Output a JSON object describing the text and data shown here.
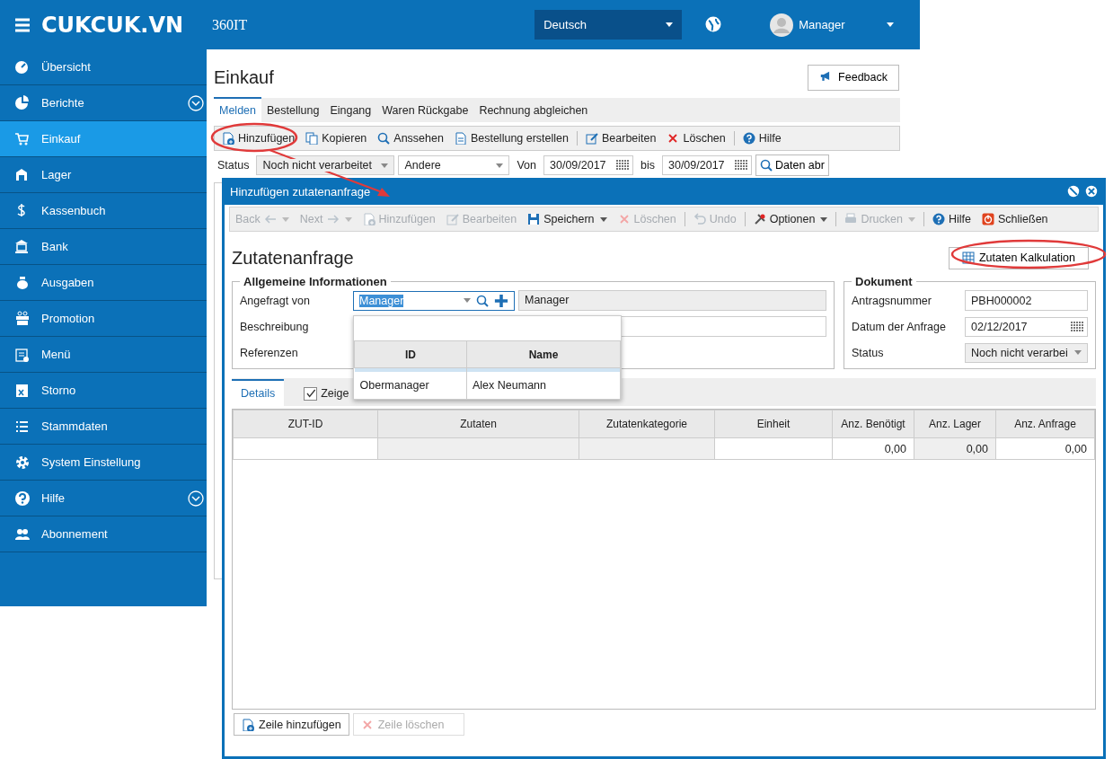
{
  "header": {
    "logo": "CUKCUK.VN",
    "company": "360IT",
    "language": "Deutsch",
    "user": "Manager"
  },
  "sidebar": {
    "items": [
      {
        "label": "Übersicht",
        "selected": false,
        "expandable": false
      },
      {
        "label": "Berichte",
        "selected": false,
        "expandable": true
      },
      {
        "label": "Einkauf",
        "selected": true,
        "expandable": false
      },
      {
        "label": "Lager",
        "selected": false,
        "expandable": false
      },
      {
        "label": "Kassenbuch",
        "selected": false,
        "expandable": false
      },
      {
        "label": "Bank",
        "selected": false,
        "expandable": false
      },
      {
        "label": "Ausgaben",
        "selected": false,
        "expandable": false
      },
      {
        "label": "Promotion",
        "selected": false,
        "expandable": false
      },
      {
        "label": "Menü",
        "selected": false,
        "expandable": false
      },
      {
        "label": "Storno",
        "selected": false,
        "expandable": false
      },
      {
        "label": "Stammdaten",
        "selected": false,
        "expandable": false
      },
      {
        "label": "System Einstellung",
        "selected": false,
        "expandable": false
      },
      {
        "label": "Hilfe",
        "selected": false,
        "expandable": true
      },
      {
        "label": "Abonnement",
        "selected": false,
        "expandable": false
      }
    ]
  },
  "page": {
    "title": "Einkauf",
    "feedback": "Feedback",
    "tabs": [
      {
        "label": "Melden",
        "selected": true
      },
      {
        "label": "Bestellung",
        "selected": false
      },
      {
        "label": "Eingang",
        "selected": false
      },
      {
        "label": "Waren Rückgabe",
        "selected": false
      },
      {
        "label": "Rechnung abgleichen",
        "selected": false
      }
    ],
    "toolbar": [
      {
        "label": "Hinzufügen"
      },
      {
        "label": "Kopieren"
      },
      {
        "label": "Anssehen"
      },
      {
        "label": "Bestellung erstellen"
      },
      {
        "label": "Bearbeiten"
      },
      {
        "label": "Löschen"
      },
      {
        "label": "Hilfe"
      }
    ],
    "filter": {
      "status_label": "Status",
      "status_value": "Noch nicht verarbeitet",
      "type_value": "Andere",
      "from_label": "Von",
      "from_date": "30/09/2017",
      "to_label": "bis",
      "to_date": "30/09/2017",
      "load_button": "Daten abr"
    }
  },
  "dialog": {
    "title": "Hinzufügen zutatenanfrage",
    "toolbar": [
      {
        "label": "Back",
        "disabled": true,
        "dropdown": true
      },
      {
        "label": "Next",
        "disabled": true,
        "dropdown": true
      },
      {
        "label": "Hinzufügen",
        "disabled": true,
        "dropdown": false
      },
      {
        "label": "Bearbeiten",
        "disabled": true,
        "dropdown": false
      },
      {
        "label": "Speichern",
        "disabled": false,
        "dropdown": true
      },
      {
        "label": "Löschen",
        "disabled": true,
        "dropdown": false
      },
      {
        "label": "Undo",
        "disabled": true,
        "dropdown": false
      },
      {
        "label": "Optionen",
        "disabled": false,
        "dropdown": true
      },
      {
        "label": "Drucken",
        "disabled": true,
        "dropdown": true
      },
      {
        "label": "Hilfe",
        "disabled": false,
        "dropdown": false
      },
      {
        "label": "Schließen",
        "disabled": false,
        "dropdown": false
      }
    ],
    "heading": "Zutatenanfrage",
    "calc_button": "Zutaten Kalkulation",
    "general": {
      "legend": "Allgemeine Informationen",
      "requested_by_label": "Angefragt von",
      "requested_by_value": "Manager",
      "requested_by_name": "Manager",
      "description_label": "Beschreibung",
      "references_label": "Referenzen"
    },
    "document": {
      "legend": "Dokument",
      "number_label": "Antragsnummer",
      "number_value": "PBH000002",
      "date_label": "Datum der Anfrage",
      "date_value": "02/12/2017",
      "status_label": "Status",
      "status_value": "Noch nicht verarbei"
    },
    "lookup": {
      "columns": [
        "ID",
        "Name"
      ],
      "rows": [
        [
          "Obermanager",
          "Alex Neumann"
        ]
      ]
    },
    "tabs": [
      {
        "label": "Details",
        "selected": true
      }
    ],
    "show_checkbox": {
      "label": "Zeige",
      "checked": true
    },
    "table": {
      "columns": [
        "ZUT-ID",
        "Zutaten",
        "Zutatenkategorie",
        "Einheit",
        "Anz. Benötigt",
        "Anz. Lager",
        "Anz. Anfrage"
      ],
      "rows": [
        [
          "",
          "",
          "",
          "",
          "0,00",
          "0,00",
          "0,00"
        ]
      ]
    },
    "buttons": [
      {
        "label": "Zeile hinzufügen",
        "disabled": false
      },
      {
        "label": "Zeile löschen",
        "disabled": true
      }
    ]
  }
}
